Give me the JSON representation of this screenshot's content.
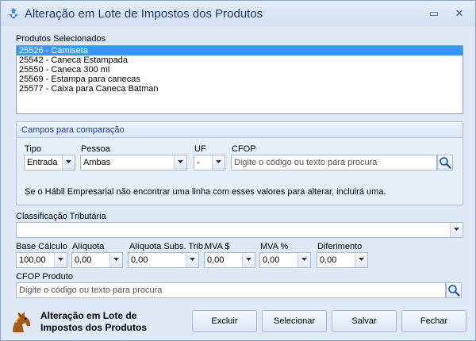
{
  "window": {
    "title": "Alteração em Lote de Impostos dos Produtos",
    "minimize_glyph": "▭",
    "close_glyph": "✕"
  },
  "produtos": {
    "label": "Produtos Selecionados",
    "items": [
      "25526 - Camiseta",
      "25542 - Caneca Estampada",
      "25550 - Caneca 300 ml",
      "25569 - Estampa para canecas",
      "25577 - Caixa para Caneca Batman"
    ],
    "selected_index": 0
  },
  "campos": {
    "title": "Campos para comparação",
    "tipo_label": "Tipo",
    "tipo_value": "Entrada",
    "pessoa_label": "Pessoa",
    "pessoa_value": "Ambas",
    "uf_label": "UF",
    "uf_value": "-",
    "cfop_label": "CFOP",
    "cfop_placeholder": "Digite o código ou texto para procura",
    "info": "Se o Hábil Empresarial não encontrar uma linha com esses valores para alterar, incluirá uma."
  },
  "classificacao": {
    "label": "Classificação Tributária",
    "value": ""
  },
  "impostos": {
    "base_label": "Base Cálculo",
    "base_value": "100,00",
    "aliquota_label": "Alíquota",
    "aliquota_value": "0,00",
    "aliquota_st_label": "Alíquota Subs. Trib.",
    "aliquota_st_value": "0,00",
    "mva_label": "MVA $",
    "mva_value": "0,00",
    "mva_pct_label": "MVA %",
    "mva_pct_value": "0,00",
    "diferimento_label": "Diferimento",
    "diferimento_value": "0,00"
  },
  "cfop_produto": {
    "label": "CFOP Produto",
    "placeholder": "Digite o código ou texto para procura"
  },
  "footer": {
    "title": "Alteração em Lote de Impostos dos Produtos",
    "excluir": "Excluir",
    "selecionar": "Selecionar",
    "salvar": "Salvar",
    "fechar": "Fechar"
  },
  "icons": {
    "app": "recycle-icon",
    "search": "magnifier-icon",
    "dropdown": "chevron-down-icon",
    "logo": "horse-logo-icon"
  },
  "colors": {
    "selection": "#3399ff",
    "window_bg": "#dfe8f5",
    "title_text": "#1d3b6a"
  }
}
